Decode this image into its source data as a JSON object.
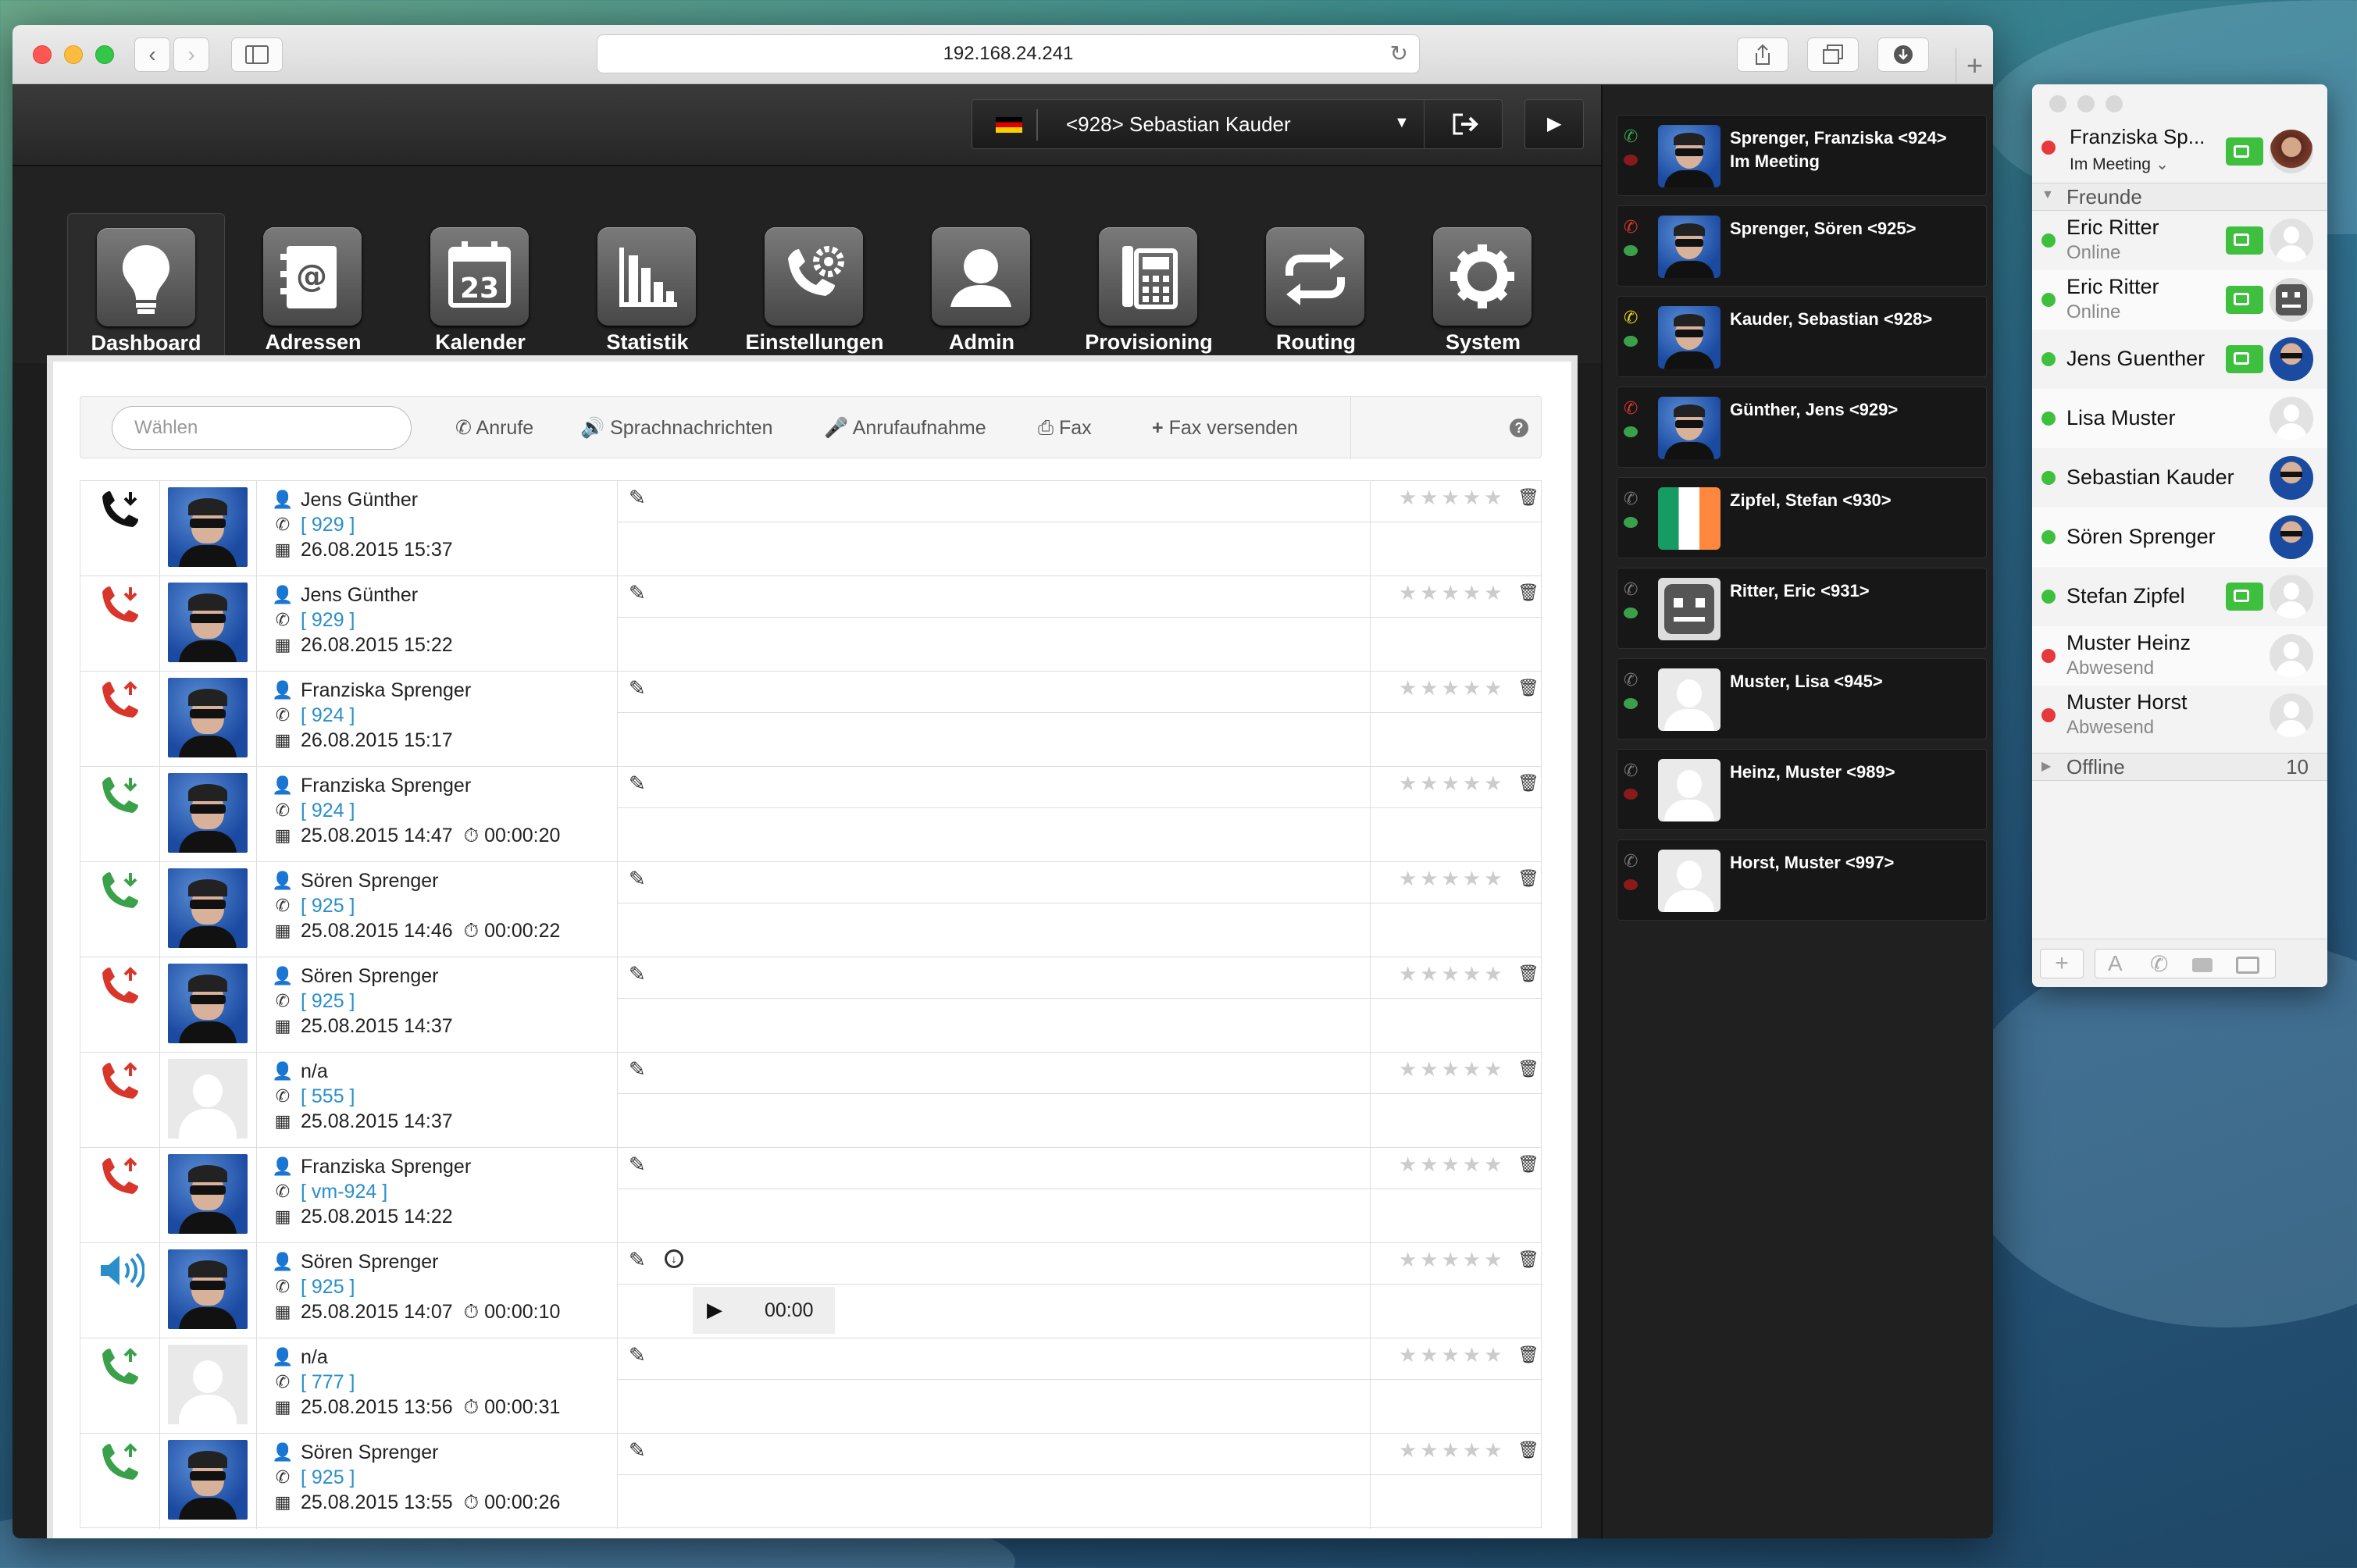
{
  "browser": {
    "url": "192.168.24.241"
  },
  "header": {
    "user_selector": "<928> Sebastian Kauder"
  },
  "nav": [
    {
      "label": "Dashboard",
      "icon": "lightbulb-icon",
      "active": true
    },
    {
      "label": "Adressen",
      "icon": "address-book-icon",
      "active": false
    },
    {
      "label": "Kalender",
      "icon": "calendar-icon",
      "active": false,
      "badge": "23"
    },
    {
      "label": "Statistik",
      "icon": "bar-chart-icon",
      "active": false
    },
    {
      "label": "Einstellungen",
      "icon": "phone-gear-icon",
      "active": false
    },
    {
      "label": "Admin",
      "icon": "user-icon",
      "active": false
    },
    {
      "label": "Provisioning",
      "icon": "desk-phone-icon",
      "active": false
    },
    {
      "label": "Routing",
      "icon": "routing-arrows-icon",
      "active": false
    },
    {
      "label": "System",
      "icon": "gear-icon",
      "active": false
    }
  ],
  "toolbar": {
    "search_placeholder": "Wählen",
    "items": [
      "Anrufe",
      "Sprachnachrichten",
      "Anrufaufnahme",
      "Fax",
      "Fax versenden"
    ]
  },
  "calls": [
    {
      "kind": "incoming",
      "color": "#111111",
      "avatar": "photo",
      "name": "Jens Günther",
      "ext": "[ 929 ]",
      "date": "26.08.2015 15:37",
      "duration": ""
    },
    {
      "kind": "incoming",
      "color": "#d9362b",
      "avatar": "photo",
      "name": "Jens Günther",
      "ext": "[ 929 ]",
      "date": "26.08.2015 15:22",
      "duration": ""
    },
    {
      "kind": "outgoing",
      "color": "#d9362b",
      "avatar": "photo",
      "name": "Franziska Sprenger",
      "ext": "[ 924 ]",
      "date": "26.08.2015 15:17",
      "duration": ""
    },
    {
      "kind": "incoming",
      "color": "#3aa14a",
      "avatar": "photo",
      "name": "Franziska Sprenger",
      "ext": "[ 924 ]",
      "date": "25.08.2015 14:47",
      "duration": "00:00:20"
    },
    {
      "kind": "incoming",
      "color": "#3aa14a",
      "avatar": "photo",
      "name": "Sören Sprenger",
      "ext": "[ 925 ]",
      "date": "25.08.2015 14:46",
      "duration": "00:00:22"
    },
    {
      "kind": "outgoing",
      "color": "#d9362b",
      "avatar": "photo",
      "name": "Sören Sprenger",
      "ext": "[ 925 ]",
      "date": "25.08.2015 14:37",
      "duration": ""
    },
    {
      "kind": "outgoing",
      "color": "#d9362b",
      "avatar": "blank",
      "name": "n/a",
      "ext": "[ 555 ]",
      "date": "25.08.2015 14:37",
      "duration": ""
    },
    {
      "kind": "outgoing",
      "color": "#d9362b",
      "avatar": "photo",
      "name": "Franziska Sprenger",
      "ext": "[ vm-924 ]",
      "date": "25.08.2015 14:22",
      "duration": ""
    },
    {
      "kind": "voicemail",
      "color": "#2a8fc9",
      "avatar": "photo",
      "name": "Sören Sprenger",
      "ext": "[ 925 ]",
      "date": "25.08.2015 14:07",
      "duration": "00:00:10",
      "player_time": "00:00"
    },
    {
      "kind": "outgoing",
      "color": "#3aa14a",
      "avatar": "blank",
      "name": "n/a",
      "ext": "[ 777 ]",
      "date": "25.08.2015 13:56",
      "duration": "00:00:31"
    },
    {
      "kind": "outgoing",
      "color": "#3aa14a",
      "avatar": "photo",
      "name": "Sören Sprenger",
      "ext": "[ 925 ]",
      "date": "25.08.2015 13:55",
      "duration": "00:00:26"
    }
  ],
  "presence": [
    {
      "name": "Sprenger, Franziska <924>",
      "status": "Im Meeting",
      "phone_color": "#3aa14a",
      "chat_color": "#8a1a1a",
      "avatar": "photo"
    },
    {
      "name": "Sprenger, Sören <925>",
      "status": "",
      "phone_color": "#d9362b",
      "chat_color": "#3aa14a",
      "avatar": "photo"
    },
    {
      "name": "Kauder, Sebastian <928>",
      "status": "",
      "phone_color": "#e5d21a",
      "chat_color": "#3aa14a",
      "avatar": "photo"
    },
    {
      "name": "Günther, Jens <929>",
      "status": "",
      "phone_color": "#d9362b",
      "chat_color": "#3aa14a",
      "avatar": "photo"
    },
    {
      "name": "Zipfel, Stefan <930>",
      "status": "",
      "phone_color": "#777777",
      "chat_color": "#3aa14a",
      "avatar": "flag"
    },
    {
      "name": "Ritter, Eric <931>",
      "status": "",
      "phone_color": "#777777",
      "chat_color": "#3aa14a",
      "avatar": "robot"
    },
    {
      "name": "Muster, Lisa <945>",
      "status": "",
      "phone_color": "#777777",
      "chat_color": "#3aa14a",
      "avatar": "blank"
    },
    {
      "name": "Heinz, Muster <989>",
      "status": "",
      "phone_color": "#777777",
      "chat_color": "#8a1a1a",
      "avatar": "blank"
    },
    {
      "name": "Horst, Muster <997>",
      "status": "",
      "phone_color": "#777777",
      "chat_color": "#8a1a1a",
      "avatar": "blank"
    }
  ],
  "messages": {
    "me_name": "Franziska Sp...",
    "me_status": "Im Meeting",
    "group_friends": "Freunde",
    "buddies": [
      {
        "name": "Eric Ritter",
        "status": "Online",
        "dot": "#3ec03e",
        "video": true,
        "avatar": "blank"
      },
      {
        "name": "Eric Ritter",
        "status": "Online",
        "dot": "#3ec03e",
        "video": true,
        "avatar": "robot"
      },
      {
        "name": "Jens Guenther",
        "status": "",
        "dot": "#3ec03e",
        "video": true,
        "avatar": "photo"
      },
      {
        "name": "Lisa Muster",
        "status": "",
        "dot": "#3ec03e",
        "video": false,
        "avatar": "blank"
      },
      {
        "name": "Sebastian Kauder",
        "status": "",
        "dot": "#3ec03e",
        "video": false,
        "avatar": "photo"
      },
      {
        "name": "Sören Sprenger",
        "status": "",
        "dot": "#3ec03e",
        "video": false,
        "avatar": "photo"
      },
      {
        "name": "Stefan Zipfel",
        "status": "",
        "dot": "#3ec03e",
        "video": true,
        "avatar": "blank"
      },
      {
        "name": "Muster Heinz",
        "status": "Abwesend",
        "dot": "#e6393b",
        "video": false,
        "avatar": "blank"
      },
      {
        "name": "Muster Horst",
        "status": "Abwesend",
        "dot": "#e6393b",
        "video": false,
        "avatar": "blank"
      }
    ],
    "group_offline": "Offline",
    "offline_count": "10"
  }
}
